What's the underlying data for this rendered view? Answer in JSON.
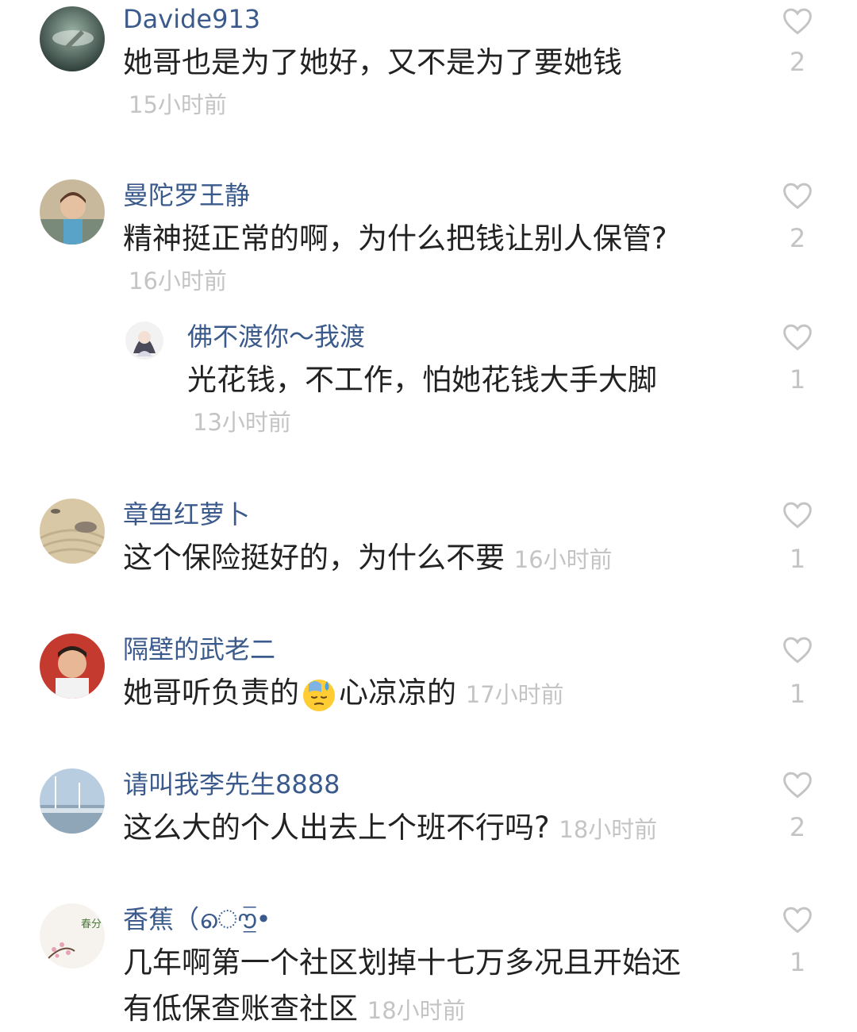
{
  "colors": {
    "username": "#3b5a8c",
    "text": "#222222",
    "meta": "#c4c4c4",
    "background": "#ffffff"
  },
  "comments": [
    {
      "username": "Davide913",
      "text": "她哥也是为了她好，又不是为了要她钱",
      "time": "15小时前",
      "likes": "2",
      "icon": "heart-outline-icon"
    },
    {
      "username": "曼陀罗王静",
      "text": "精神挺正常的啊，为什么把钱让别人保管?",
      "time": "16小时前",
      "likes": "2",
      "icon": "heart-outline-icon"
    },
    {
      "username": "佛不渡你～我渡",
      "text": "光花钱，不工作，怕她花钱大手大脚",
      "time": "13小时前",
      "likes": "1",
      "icon": "heart-outline-icon"
    },
    {
      "username": "章鱼红萝卜",
      "text": "这个保险挺好的，为什么不要",
      "time": "16小时前",
      "likes": "1",
      "icon": "heart-outline-icon"
    },
    {
      "username": "隔壁的武老二",
      "text_a": "她哥听负责的",
      "emoji": "sweat-emoji",
      "text_b": "心凉凉的",
      "time": "17小时前",
      "likes": "1",
      "icon": "heart-outline-icon"
    },
    {
      "username": "请叫我李先生8888",
      "text": "这么大的个人出去上个班不行吗?",
      "time": "18小时前",
      "likes": "2",
      "icon": "heart-outline-icon"
    },
    {
      "username": "香蕉（ൌ̲̅•",
      "text_line1": "几年啊第一个社区划掉十七万多况且开始还",
      "text_line2": "有低保查账查社区",
      "time": "18小时前",
      "likes": "1",
      "icon": "heart-outline-icon",
      "avatar_text": "春分"
    }
  ]
}
